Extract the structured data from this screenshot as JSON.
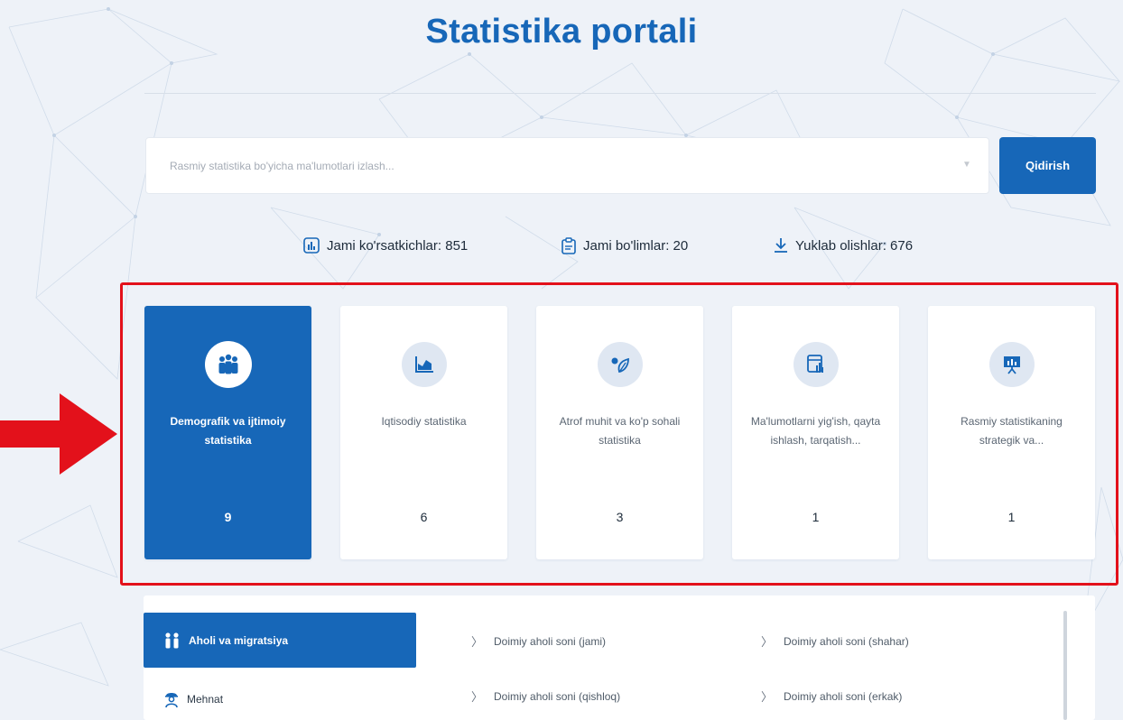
{
  "header": {
    "title": "Statistika portali"
  },
  "search": {
    "placeholder": "Rasmiy statistika bo'yicha ma'lumotlari izlash...",
    "button_label": "Qidirish"
  },
  "stats": [
    {
      "icon": "bar-chart-icon",
      "label": "Jami ko'rsatkichlar: 851"
    },
    {
      "icon": "clipboard-icon",
      "label": "Jami bo'limlar: 20"
    },
    {
      "icon": "download-icon",
      "label": "Yuklab olishlar: 676"
    }
  ],
  "categories": [
    {
      "icon": "people-group-icon",
      "label": "Demografik va ijtimoiy statistika",
      "count": "9",
      "active": true
    },
    {
      "icon": "area-chart-icon",
      "label": "Iqtisodiy statistika",
      "count": "6",
      "active": false
    },
    {
      "icon": "eco-leaf-icon",
      "label": "Atrof muhit va ko'p sohali statistika",
      "count": "3",
      "active": false
    },
    {
      "icon": "data-report-icon",
      "label": "Ma'lumotlarni yig'ish, qayta ishlash, tarqatish...",
      "count": "1",
      "active": false
    },
    {
      "icon": "presentation-board-icon",
      "label": "Rasmiy statistikaning strategik va...",
      "count": "1",
      "active": false
    }
  ],
  "subnav": [
    {
      "icon": "people-icon",
      "label": "Aholi va migratsiya",
      "active": true
    },
    {
      "icon": "worker-icon",
      "label": "Mehnat",
      "active": false
    }
  ],
  "links": [
    "Doimiy aholi soni (jami)",
    "Doimiy aholi soni (shahar)",
    "Doimiy aholi soni (qishloq)",
    "Doimiy aholi soni (erkak)"
  ],
  "colors": {
    "brand": "#1767b8",
    "highlight": "#e3111b",
    "background": "#eef2f8"
  }
}
